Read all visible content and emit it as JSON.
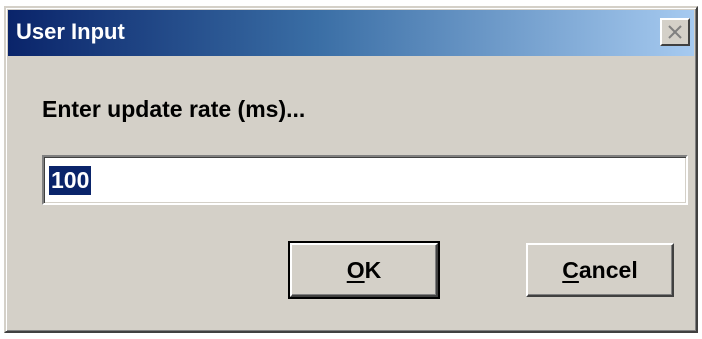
{
  "window": {
    "title": "User Input",
    "close_icon": "close-icon"
  },
  "dialog": {
    "prompt": "Enter update rate (ms)...",
    "input_value": "100"
  },
  "buttons": {
    "ok": {
      "mnemonic": "O",
      "rest": "K"
    },
    "cancel": {
      "mnemonic": "C",
      "rest": "ancel"
    }
  },
  "colors": {
    "title_bar_start": "#0a246a",
    "title_bar_end": "#a6caf0",
    "face": "#d4d0c8",
    "selection": "#0a246a"
  }
}
